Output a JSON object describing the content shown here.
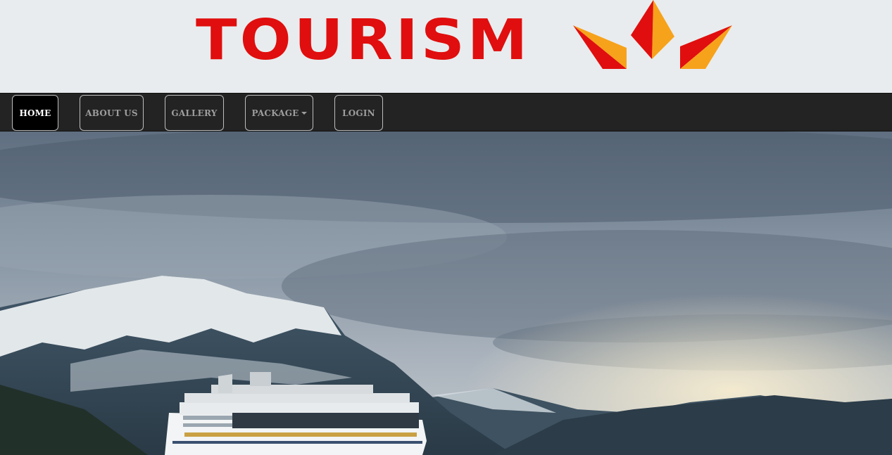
{
  "brand": {
    "name": "TOURISM"
  },
  "nav": {
    "items": [
      {
        "label": "HOME",
        "active": true
      },
      {
        "label": "ABOUT US",
        "active": false
      },
      {
        "label": "GALLERY",
        "active": false
      },
      {
        "label": "PACKAGE",
        "active": false,
        "dropdown": true
      },
      {
        "label": "LOGIN",
        "active": false
      }
    ]
  },
  "colors": {
    "brand_red": "#e00e0e",
    "brand_orange": "#f7a21b",
    "navbar_bg": "#232323",
    "header_bg": "#e9ecee"
  }
}
